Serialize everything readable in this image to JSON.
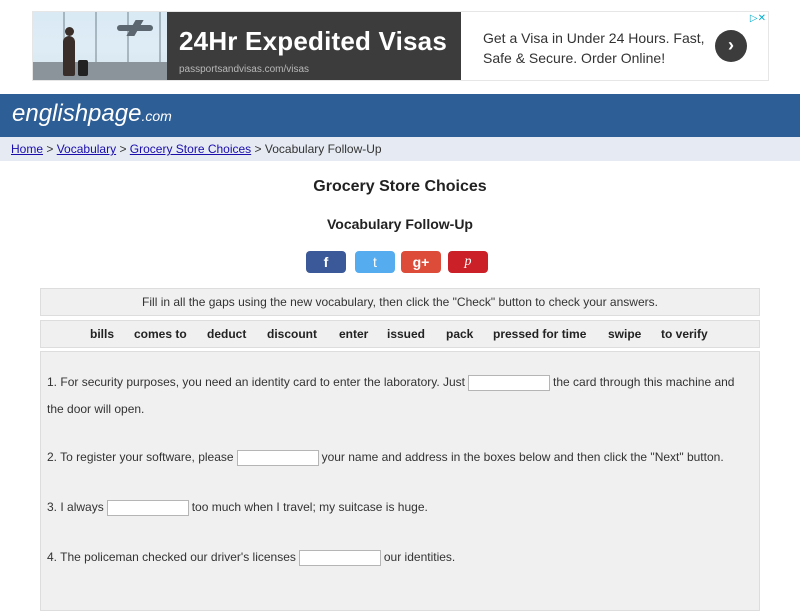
{
  "ad": {
    "title": "24Hr Expedited Visas",
    "url": "passportsandvisas.com/visas",
    "text": "Get a Visa in Under 24 Hours. Fast, Safe & Secure. Order Online!",
    "go_icon": "chevron-right-icon",
    "go_glyph": "›",
    "info_glyph": "▷✕"
  },
  "site": {
    "logo_main": "englishpage",
    "logo_domain": ".com"
  },
  "breadcrumb": {
    "items": [
      "Home",
      "Vocabulary",
      "Grocery Store Choices"
    ],
    "separator": ">",
    "current": "Vocabulary Follow-Up"
  },
  "page": {
    "title": "Grocery Store Choices",
    "subtitle": "Vocabulary Follow-Up"
  },
  "social": [
    {
      "label": "f",
      "icon": "facebook-icon",
      "color": "#3b5998"
    },
    {
      "label": "t",
      "icon": "twitter-icon",
      "color": "#55acee"
    },
    {
      "label": "g+",
      "icon": "google-plus-icon",
      "color": "#dd4b39"
    },
    {
      "label": "p",
      "icon": "pinterest-icon",
      "color": "#cb2027"
    }
  ],
  "instructions": "Fill in all the gaps using the new vocabulary, then click the \"Check\" button to check your answers.",
  "word_bank": [
    "bills",
    "comes to",
    "deduct",
    "discount",
    "enter",
    "issued",
    "pack",
    "pressed for time",
    "swipe",
    "to verify"
  ],
  "questions": [
    {
      "number": "1.",
      "before": "For security purposes, you need an identity card to enter the laboratory. Just",
      "after": "the card through this machine and",
      "continuation": "the door will open.",
      "answer": ""
    },
    {
      "number": "2.",
      "before": "To register your software, please",
      "after": "your name and address in the boxes below and then click the \"Next\" button.",
      "answer": ""
    },
    {
      "number": "3.",
      "before": "I always",
      "after": "too much when I travel; my suitcase is huge.",
      "answer": ""
    },
    {
      "number": "4.",
      "before": "The policeman checked our driver's licenses",
      "after": "our identities.",
      "answer": ""
    }
  ],
  "colors": {
    "header_bg": "#2d5e95",
    "breadcrumb_bg": "#e6ebf3",
    "panel_bg": "#f0f0f0",
    "link": "#1a0dab"
  }
}
